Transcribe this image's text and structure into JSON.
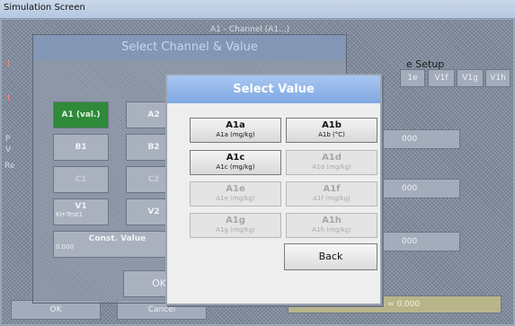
{
  "window": {
    "title": "Simulation Screen"
  },
  "background": {
    "channel_label": "A1 - Channel (A1...)",
    "setup_label": "e Setup",
    "tabs": [
      "1e",
      "V1f",
      "V1g",
      "V1h"
    ],
    "values": [
      "000",
      "000",
      "000"
    ],
    "status_value": "V1a = 0.000",
    "ok_label": "OK",
    "cancel_label": "Cancel",
    "left_letters": [
      "I",
      "I",
      "P",
      "V",
      "Re"
    ]
  },
  "select_channel": {
    "title": "Select Channel & Value",
    "buttons": [
      {
        "label": "A1 (val.)",
        "sub": ""
      },
      {
        "label": "A2",
        "sub": ""
      },
      {
        "label": "B1",
        "sub": ""
      },
      {
        "label": "B2",
        "sub": ""
      },
      {
        "label": "C1",
        "sub": ""
      },
      {
        "label": "C2",
        "sub": ""
      },
      {
        "label": "V1",
        "sub": "KH-Test1"
      },
      {
        "label": "V2",
        "sub": ""
      }
    ],
    "const_value_label": "Const. Value",
    "const_value": "0.000",
    "ok_label": "OK"
  },
  "select_value": {
    "title": "Select Value",
    "options": [
      {
        "name": "A1a",
        "unit": "A1a (mg/kg)",
        "enabled": true
      },
      {
        "name": "A1b",
        "unit": "A1b (°C)",
        "enabled": true
      },
      {
        "name": "A1c",
        "unit": "A1c (mg/kg)",
        "enabled": true
      },
      {
        "name": "A1d",
        "unit": "A1d (mg/kg)",
        "enabled": false
      },
      {
        "name": "A1e",
        "unit": "A1e (mg/kg)",
        "enabled": false
      },
      {
        "name": "A1f",
        "unit": "A1f (mg/kg)",
        "enabled": false
      },
      {
        "name": "A1g",
        "unit": "A1g (mg/kg)",
        "enabled": false
      },
      {
        "name": "A1h",
        "unit": "A1h (mg/kg)",
        "enabled": false
      }
    ],
    "back_label": "Back"
  }
}
